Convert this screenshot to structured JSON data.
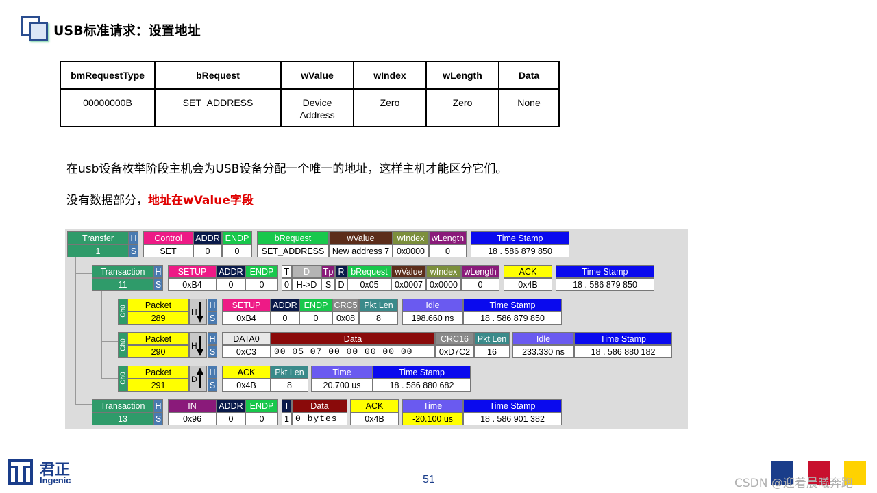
{
  "title": "USB标准请求：设置地址",
  "request_table": {
    "headers": [
      "bmRequestType",
      "bRequest",
      "wValue",
      "wIndex",
      "wLength",
      "Data"
    ],
    "row": [
      "00000000B",
      "SET_ADDRESS",
      "Device\nAddress",
      "Zero",
      "Zero",
      "None"
    ]
  },
  "para1": "在usb设备枚举阶段主机会为USB设备分配一个唯一的地址，这样主机才能区分它们。",
  "para2_prefix": "没有数据部分，",
  "para2_highlight": "地址在wValue字段",
  "analyzer": {
    "colors": {
      "green": "#2f9b6a",
      "pink": "#ee1a86",
      "navy": "#0a1a4a",
      "brightgreen": "#18c84c",
      "brown": "#5c2d1a",
      "olive": "#7c8f3c",
      "purple": "#8a1a7a",
      "blue": "#0a0aee",
      "yellow": "#ffff00",
      "idle": "#6a5af0",
      "darkred": "#8a0a0a",
      "gray": "#8a8a8a",
      "teal": "#3a8a8a",
      "steel": "#4a7ab0",
      "lightgray": "#b4b4b4"
    },
    "transfer": {
      "label": "Transfer",
      "num": "1",
      "h": "H",
      "s": "S",
      "control": "Control",
      "control_val": "SET",
      "addr": "ADDR",
      "addr_val": "0",
      "endp": "ENDP",
      "endp_val": "0",
      "brequest": "bRequest",
      "brequest_val": "SET_ADDRESS",
      "wvalue": "wValue",
      "wvalue_val": "New address 7",
      "windex": "wIndex",
      "windex_val": "0x0000",
      "wlength": "wLength",
      "wlength_val": "0",
      "ts": "Time Stamp",
      "ts_val": "18 . 586 879 850"
    },
    "trans11": {
      "label": "Transaction",
      "num": "11",
      "h": "H",
      "s": "S",
      "setup": "SETUP",
      "setup_val": "0xB4",
      "addr": "ADDR",
      "addr_val": "0",
      "endp": "ENDP",
      "endp_val": "0",
      "t": "T",
      "t_val": "0",
      "d": "D",
      "d_val": "H->D",
      "tp": "Tp",
      "tp_val": "S",
      "r": "R",
      "r_val": "D",
      "brequest": "bRequest",
      "brequest_val": "0x05",
      "wvalue": "wValue",
      "wvalue_val": "0x0007",
      "windex": "wIndex",
      "windex_val": "0x0000",
      "wlength": "wLength",
      "wlength_val": "0",
      "ack": "ACK",
      "ack_val": "0x4B",
      "ts": "Time Stamp",
      "ts_val": "18 . 586 879 850"
    },
    "pkt289": {
      "ch": "Ch0",
      "label": "Packet",
      "num": "289",
      "dir": "H",
      "h": "H",
      "s": "S",
      "setup": "SETUP",
      "setup_val": "0xB4",
      "addr": "ADDR",
      "addr_val": "0",
      "endp": "ENDP",
      "endp_val": "0",
      "crc5": "CRC5",
      "crc5_val": "0x08",
      "pktlen": "Pkt Len",
      "pktlen_val": "8",
      "idle": "Idle",
      "idle_val": "198.660 ns",
      "ts": "Time Stamp",
      "ts_val": "18 . 586 879 850"
    },
    "pkt290": {
      "ch": "Ch0",
      "label": "Packet",
      "num": "290",
      "dir": "H",
      "h": "H",
      "s": "S",
      "data0": "DATA0",
      "data0_val": "0xC3",
      "data": "Data",
      "data_val": "00 05 07 00 00 00 00 00",
      "crc16": "CRC16",
      "crc16_val": "0xD7C2",
      "pktlen": "Pkt Len",
      "pktlen_val": "16",
      "idle": "Idle",
      "idle_val": "233.330 ns",
      "ts": "Time Stamp",
      "ts_val": "18 . 586 880 182"
    },
    "pkt291": {
      "ch": "Ch0",
      "label": "Packet",
      "num": "291",
      "dir": "D",
      "h": "H",
      "s": "S",
      "ack": "ACK",
      "ack_val": "0x4B",
      "pktlen": "Pkt Len",
      "pktlen_val": "8",
      "time": "Time",
      "time_val": "20.700 us",
      "ts": "Time Stamp",
      "ts_val": "18 . 586 880 682"
    },
    "trans13": {
      "label": "Transaction",
      "num": "13",
      "h": "H",
      "s": "S",
      "in": "IN",
      "in_val": "0x96",
      "addr": "ADDR",
      "addr_val": "0",
      "endp": "ENDP",
      "endp_val": "0",
      "t": "T",
      "t_val": "1",
      "data": "Data",
      "data_val": "0 bytes",
      "ack": "ACK",
      "ack_val": "0x4B",
      "time": "Time",
      "time_val": "-20.100 us",
      "ts": "Time Stamp",
      "ts_val": "18 . 586 901 382"
    }
  },
  "footer": {
    "logo_cn": "君正",
    "logo_en": "Ingenic",
    "page": "51",
    "watermark": "CSDN @迎着晨曦奔跑",
    "square_colors": [
      "#1a3d8a",
      "#c8102e",
      "#ffd200"
    ]
  }
}
